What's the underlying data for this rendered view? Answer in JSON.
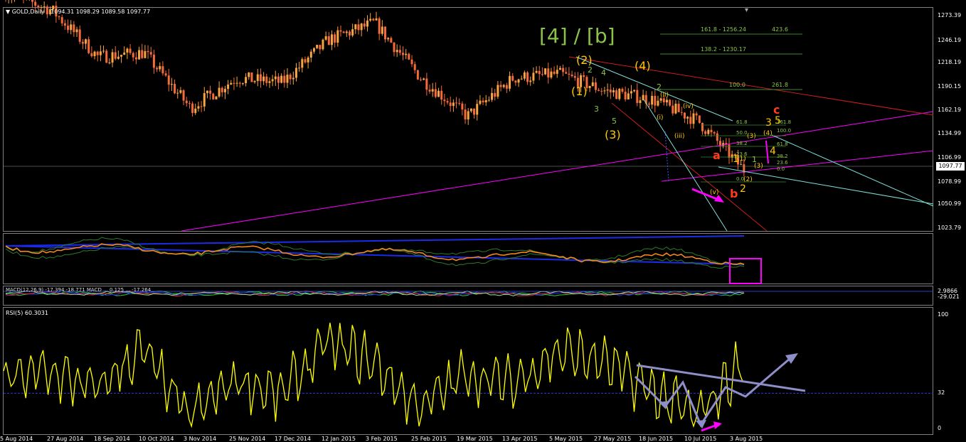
{
  "colors": {
    "background": "#000000",
    "bull_candle": "#F7A541",
    "bear_candle": "#F46A3A",
    "rsi_line": "#FFFF00",
    "channel": "#FF00FF",
    "red_line": "#C81E1E",
    "cyan_line": "#7FE0D8",
    "wave_orange": "#FFC800",
    "wave_green": "#8BC34A",
    "wave_red": "#FF3B1E",
    "grid_blue": "#1E3A8A",
    "ma_blue": "#1C2BE8",
    "ma_orange": "#FF8C1A",
    "arrow_gray": "#8E8EC8"
  },
  "main": {
    "symbol_label": "GOLD,Daily",
    "ohlc": "1094.31  1098.29  1089.58  1097.77",
    "current_price": "1097.77",
    "big_title": "[4] / [b]"
  },
  "price_scale": [
    "1273.39",
    "1246.19",
    "1218.19",
    "1190.15",
    "1162.19",
    "1134.99",
    "1106.99",
    "1078.99",
    "1050.99",
    "1023.79"
  ],
  "fib": {
    "upper": [
      {
        "text": "161.8 - 1256.24",
        "right": "423.6"
      },
      {
        "text": "138.2 - 1230.17",
        "right": ""
      },
      {
        "text": "100.0",
        "right": "261.8"
      }
    ],
    "lower": [
      "61.8",
      "50.0",
      "38.2",
      "23.6",
      "0.0"
    ],
    "lower_right": [
      "161.8",
      "100.0",
      "61.8",
      "38.2",
      "23.6",
      "0.0"
    ]
  },
  "waves": {
    "major": [
      "(2)",
      "(4)",
      "(1)",
      "(3)"
    ],
    "minor_green": [
      "2",
      "4",
      "3",
      "5",
      "2",
      "1"
    ],
    "sub": [
      "(ii)",
      "(iii)",
      "(iv)",
      "(v)",
      "(i)",
      "(1)",
      "(2)",
      "(3)",
      "(4)",
      "(3)"
    ],
    "right_labels": [
      "3",
      "5",
      "4",
      "1",
      "2"
    ],
    "abc": [
      "a",
      "b",
      "c"
    ]
  },
  "macd_label": "MACD(12,26,9) -17.394 -18.771 MACD ... 0.125 ... -17.264",
  "macd_scale": [
    "2.9866",
    "-29.021"
  ],
  "rsi": {
    "label": "RSI(5) 60.3031",
    "scale": [
      "100",
      "32",
      "0"
    ]
  },
  "x_axis": [
    "5 Aug 2014",
    "27 Aug 2014",
    "18 Sep 2014",
    "10 Oct 2014",
    "3 Nov 2014",
    "25 Nov 2014",
    "17 Dec 2014",
    "12 Jan 2015",
    "3 Feb 2015",
    "25 Feb 2015",
    "19 Mar 2015",
    "13 Apr 2015",
    "5 May 2015",
    "27 May 2015",
    "18 Jun 2015",
    "10 Jul 2015",
    "3 Aug 2015"
  ],
  "chart_data": {
    "type": "line",
    "title": "GOLD,Daily",
    "x": [
      "5 Aug 2014",
      "27 Aug 2014",
      "18 Sep 2014",
      "10 Oct 2014",
      "3 Nov 2014",
      "25 Nov 2014",
      "17 Dec 2014",
      "12 Jan 2015",
      "3 Feb 2015",
      "25 Feb 2015",
      "19 Mar 2015",
      "13 Apr 2015",
      "5 May 2015",
      "27 May 2015",
      "18 Jun 2015",
      "10 Jul 2015",
      "3 Aug 2015"
    ],
    "series": [
      {
        "name": "GOLD,Daily",
        "values": [
          1300,
          1280,
          1225,
          1230,
          1165,
          1200,
          1195,
          1245,
          1265,
          1200,
          1155,
          1200,
          1205,
          1185,
          1175,
          1150,
          1092
        ]
      },
      {
        "name": "RSI(5)",
        "values": [
          45,
          52,
          35,
          72,
          10,
          45,
          30,
          78,
          60,
          18,
          50,
          40,
          70,
          60,
          35,
          10,
          60
        ]
      }
    ],
    "ylim": [
      1023.79,
      1273.39
    ],
    "grid": false
  }
}
